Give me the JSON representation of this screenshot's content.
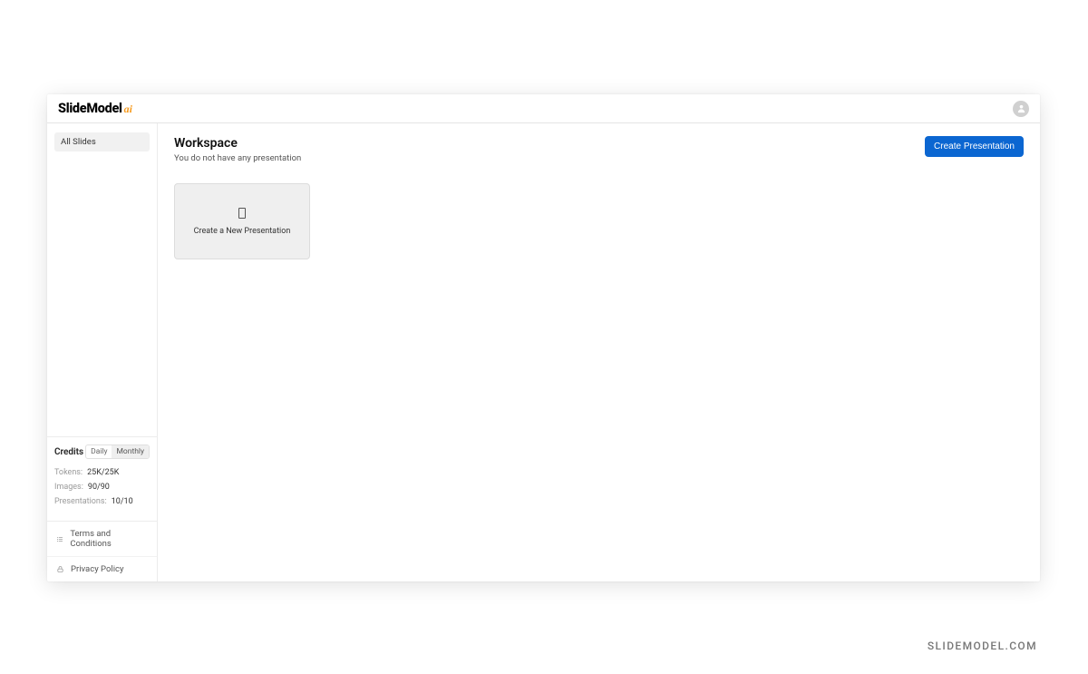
{
  "header": {
    "logo_main": "SlideModel",
    "logo_suffix": "ai"
  },
  "sidebar": {
    "nav_item": "All Slides",
    "credits_title": "Credits",
    "tabs": {
      "daily": "Daily",
      "monthly": "Monthly"
    },
    "stats": {
      "tokens_label": "Tokens:",
      "tokens_value": "25K/25K",
      "images_label": "Images:",
      "images_value": "90/90",
      "presentations_label": "Presentations:",
      "presentations_value": "10/10"
    },
    "links": {
      "terms": "Terms and Conditions",
      "privacy": "Privacy Policy"
    }
  },
  "main": {
    "title": "Workspace",
    "subtitle": "You do not have any presentation",
    "create_button": "Create Presentation",
    "card_label": "Create a New Presentation"
  },
  "watermark": "SLIDEMODEL.COM"
}
